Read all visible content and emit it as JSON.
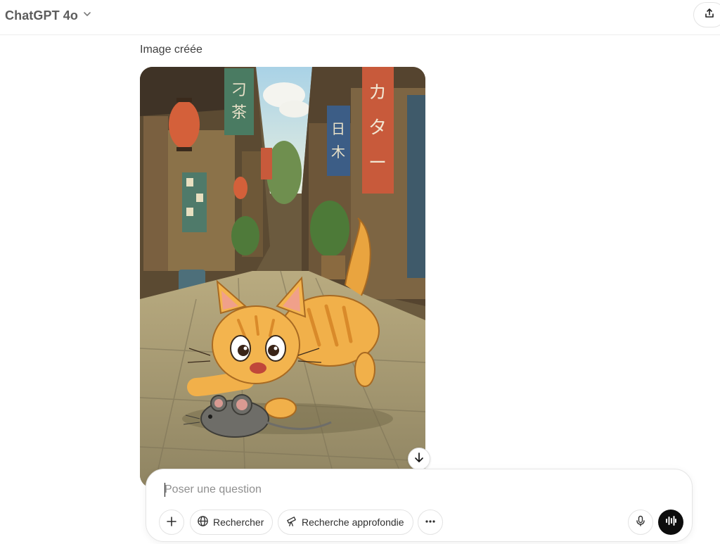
{
  "header": {
    "model_name": "ChatGPT 4o",
    "model_menu_icon": "chevron-down-icon",
    "share_icon": "share-upload-icon"
  },
  "message": {
    "status_text": "Image créée",
    "image": {
      "subject": "orange cartoon kitten chasing a gray mouse in a narrow Japanese alley with lanterns and hanging signs",
      "sign_texts": [
        "刁茶",
        "日木",
        "カター"
      ],
      "download_icon": "arrow-down-icon"
    }
  },
  "composer": {
    "placeholder": "Poser une question",
    "value": "",
    "buttons": {
      "add_icon": "plus-icon",
      "search_label": "Rechercher",
      "search_icon": "globe-icon",
      "deep_research_label": "Recherche approfondie",
      "deep_research_icon": "telescope-icon",
      "more_icon": "ellipsis-icon",
      "mic_icon": "microphone-icon",
      "voice_icon": "voice-waveform-icon"
    }
  },
  "colors": {
    "background": "#ffffff",
    "text_muted": "#5d5d5d",
    "border": "#e3e3e3",
    "voice_button": "#0d0d0d"
  }
}
